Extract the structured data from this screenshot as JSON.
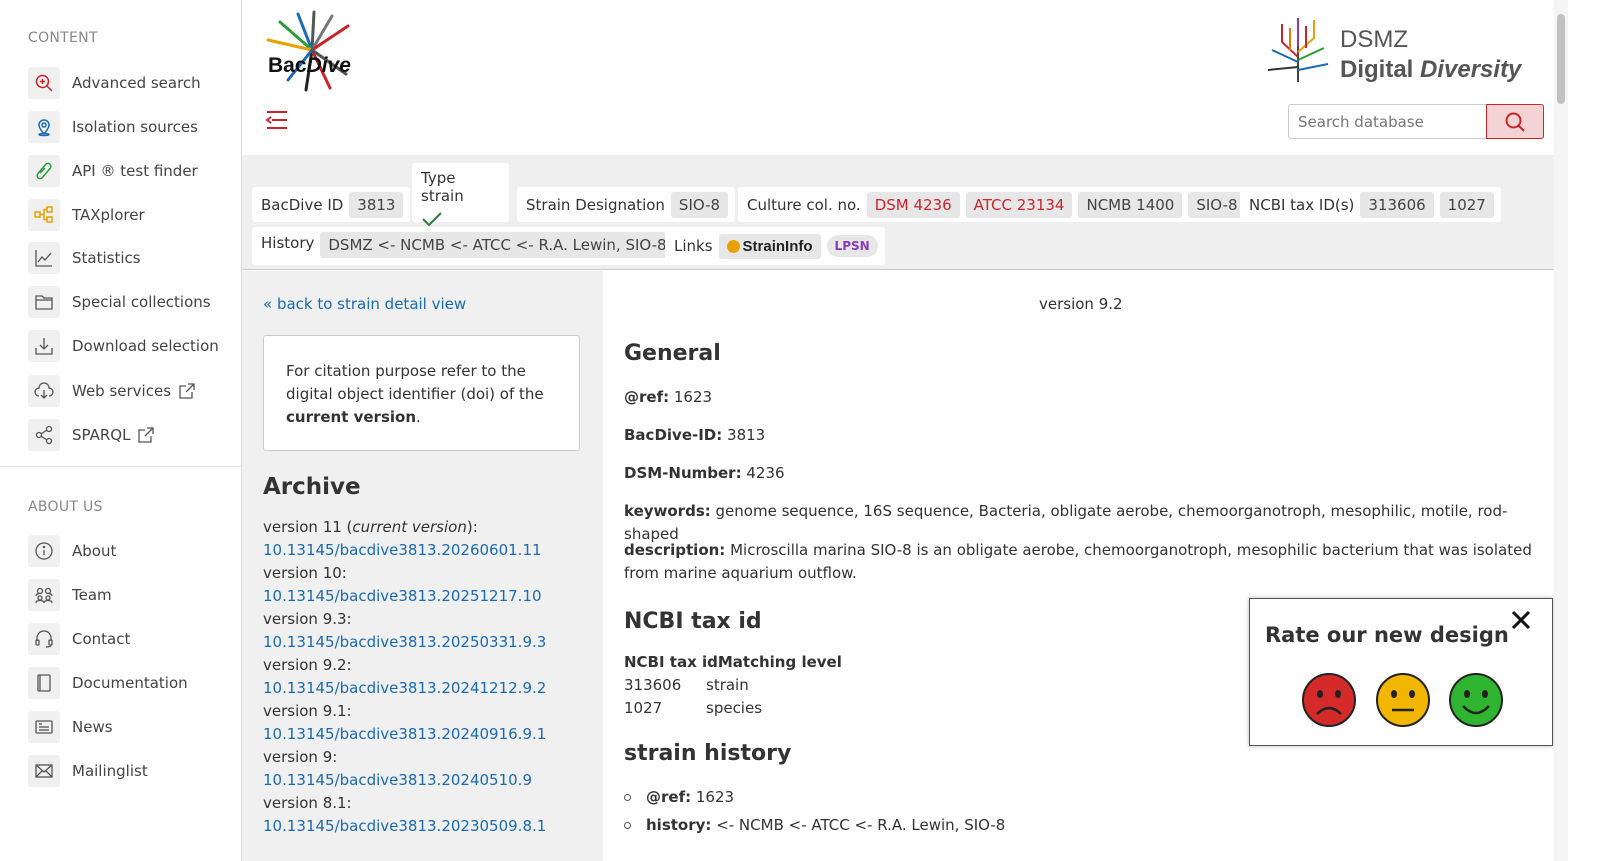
{
  "sidebar": {
    "content_heading": "CONTENT",
    "content_items": [
      {
        "label": "Advanced search",
        "icon": "search-plus-icon"
      },
      {
        "label": "Isolation sources",
        "icon": "map-pin-icon"
      },
      {
        "label": "API ® test finder",
        "icon": "test-tube-icon"
      },
      {
        "label": "TAXplorer",
        "icon": "hierarchy-icon"
      },
      {
        "label": "Statistics",
        "icon": "chart-icon"
      },
      {
        "label": "Special collections",
        "icon": "folder-icon"
      },
      {
        "label": "Download selection",
        "icon": "download-icon"
      },
      {
        "label": "Web services",
        "icon": "cloud-download-icon"
      },
      {
        "label": "SPARQL",
        "icon": "share-nodes-icon"
      }
    ],
    "about_heading": "ABOUT US",
    "about_items": [
      {
        "label": "About",
        "icon": "info-icon"
      },
      {
        "label": "Team",
        "icon": "team-icon"
      },
      {
        "label": "Contact",
        "icon": "headset-icon"
      },
      {
        "label": "Documentation",
        "icon": "book-icon"
      },
      {
        "label": "News",
        "icon": "newspaper-icon"
      },
      {
        "label": "Mailinglist",
        "icon": "mail-icon"
      }
    ]
  },
  "header": {
    "logo_part1": "Bac",
    "logo_part2": "Dive",
    "dsmz_line1": "DSMZ",
    "dsmz_line2a": "Digital ",
    "dsmz_line2b": "Diversity",
    "search_placeholder": "Search database"
  },
  "strain": {
    "bacdive_id_label": "BacDive ID",
    "bacdive_id": "3813",
    "type_strain_label": "Type strain",
    "designation_label": "Strain Designation",
    "designation": "SIO-8",
    "culture_label": "Culture col. no.",
    "culture_nos": [
      "DSM 4236",
      "ATCC 23134",
      "NCMB 1400",
      "SIO-8"
    ],
    "ncbi_label": "NCBI tax ID(s)",
    "ncbi_ids": [
      "313606",
      "1027"
    ],
    "history_label": "History",
    "history": "DSMZ <- NCMB <- ATCC <- R.A. Lewin, SIO-8",
    "links_label": "Links",
    "link_straininfo": "StrainInfo",
    "link_lpsn": "LPSN"
  },
  "left": {
    "back_link": "« back to strain detail view",
    "cite_text_1": "For citation purpose refer to the digital object identifier (doi) of the ",
    "cite_bold": "current version",
    "cite_end": ".",
    "archive_title": "Archive",
    "versions": [
      {
        "label": "version 11 (",
        "italic": "current version",
        "suffix": "):",
        "doi": "10.13145/bacdive3813.20260601.11"
      },
      {
        "label": "version 10:",
        "italic": "",
        "suffix": "",
        "doi": "10.13145/bacdive3813.20251217.10"
      },
      {
        "label": "version 9.3:",
        "italic": "",
        "suffix": "",
        "doi": "10.13145/bacdive3813.20250331.9.3"
      },
      {
        "label": "version 9.2:",
        "italic": "",
        "suffix": "",
        "doi": "10.13145/bacdive3813.20241212.9.2"
      },
      {
        "label": "version 9.1:",
        "italic": "",
        "suffix": "",
        "doi": "10.13145/bacdive3813.20240916.9.1"
      },
      {
        "label": "version 9:",
        "italic": "",
        "suffix": "",
        "doi": "10.13145/bacdive3813.20240510.9"
      },
      {
        "label": "version 8.1:",
        "italic": "",
        "suffix": "",
        "doi": "10.13145/bacdive3813.20230509.8.1"
      }
    ]
  },
  "main": {
    "version": "version 9.2",
    "general_title": "General",
    "ref_label": "@ref:",
    "ref_value": "1623",
    "bacdive_label": "BacDive-ID:",
    "bacdive_value": "3813",
    "dsm_label": "DSM-Number:",
    "dsm_value": "4236",
    "keywords_label": "keywords:",
    "keywords_value": "genome sequence, 16S sequence, Bacteria, obligate aerobe, chemoorganotroph, mesophilic, motile, rod-shaped",
    "description_label": "description:",
    "description_value": "Microscilla marina SIO-8 is an obligate aerobe, chemoorganotroph, mesophilic bacterium that was isolated from marine aquarium outflow.",
    "ncbi_title": "NCBI tax id",
    "ncbi_col1": "NCBI tax id",
    "ncbi_col2": "Matching level",
    "ncbi_rows": [
      [
        "313606",
        "strain"
      ],
      [
        "1027",
        "species"
      ]
    ],
    "history_title": "strain history",
    "hist_ref_label": "@ref:",
    "hist_ref_value": "1623",
    "hist_label": "history:",
    "hist_value": "<- NCMB <- ATCC <- R.A. Lewin, SIO-8"
  },
  "rating": {
    "title": "Rate our new design",
    "colors": {
      "sad": "#d42a2a",
      "neutral": "#f2b600",
      "happy": "#2fb52f"
    }
  },
  "colors": {
    "accent": "#c9252b",
    "link": "#1a6ab5"
  }
}
